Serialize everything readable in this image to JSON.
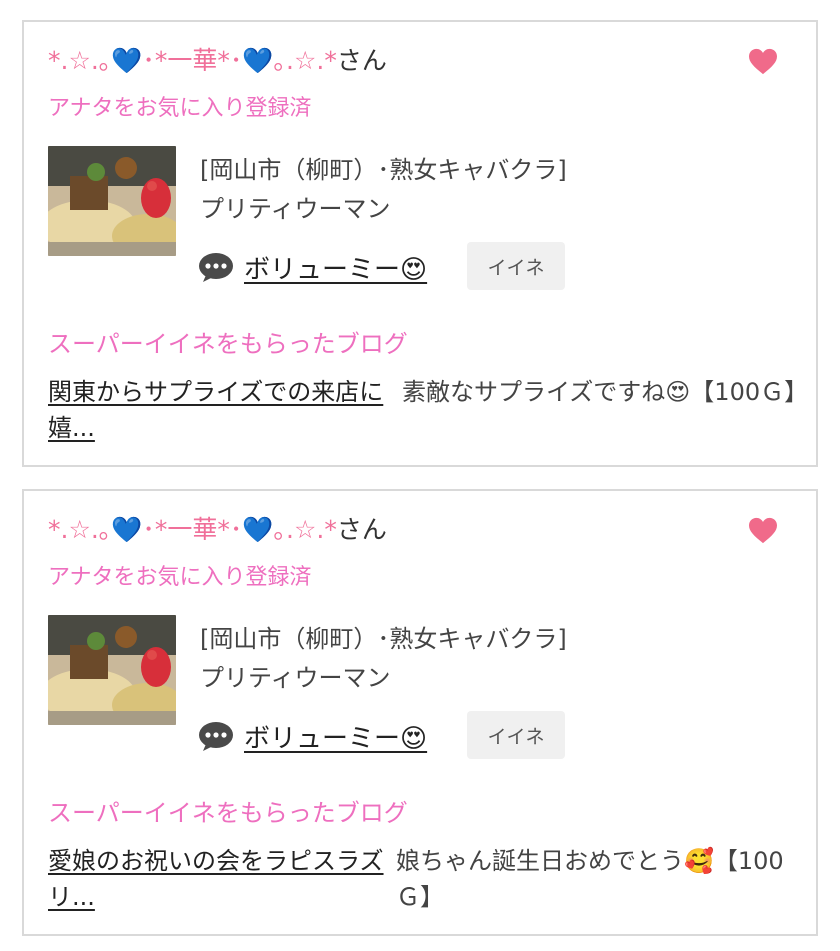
{
  "colors": {
    "accent_pink": "#ee6fbf",
    "heart": "#f06a8a",
    "border": "#d9d9d9"
  },
  "cards": [
    {
      "user_name": "*.☆.｡💙･*一華*･💙｡.☆.*",
      "user_suffix": "さん",
      "favorite_status": "アナタをお気に入り登録済",
      "shop_category": "[岡山市（柳町）･熟女キャバクラ]",
      "shop_name": "プリティウーマン",
      "blog_title": "ボリューミー😍",
      "iine_label": "イイネ",
      "super_iine_label": "スーパーイイネをもらったブログ",
      "post_title": "関東からサプライズでの来店に嬉...",
      "post_comment": "素敵なサプライズですね😍【100Ｇ】",
      "heart_icon": "heart-icon",
      "comment_icon": "speech-bubble-icon"
    },
    {
      "user_name": "*.☆.｡💙･*一華*･💙｡.☆.*",
      "user_suffix": "さん",
      "favorite_status": "アナタをお気に入り登録済",
      "shop_category": "[岡山市（柳町）･熟女キャバクラ]",
      "shop_name": "プリティウーマン",
      "blog_title": "ボリューミー😍",
      "iine_label": "イイネ",
      "super_iine_label": "スーパーイイネをもらったブログ",
      "post_title": "愛娘のお祝いの会をラピスラズリ...",
      "post_comment": "娘ちゃん誕生日おめでとう🥰【100Ｇ】",
      "heart_icon": "heart-icon",
      "comment_icon": "speech-bubble-icon"
    }
  ]
}
